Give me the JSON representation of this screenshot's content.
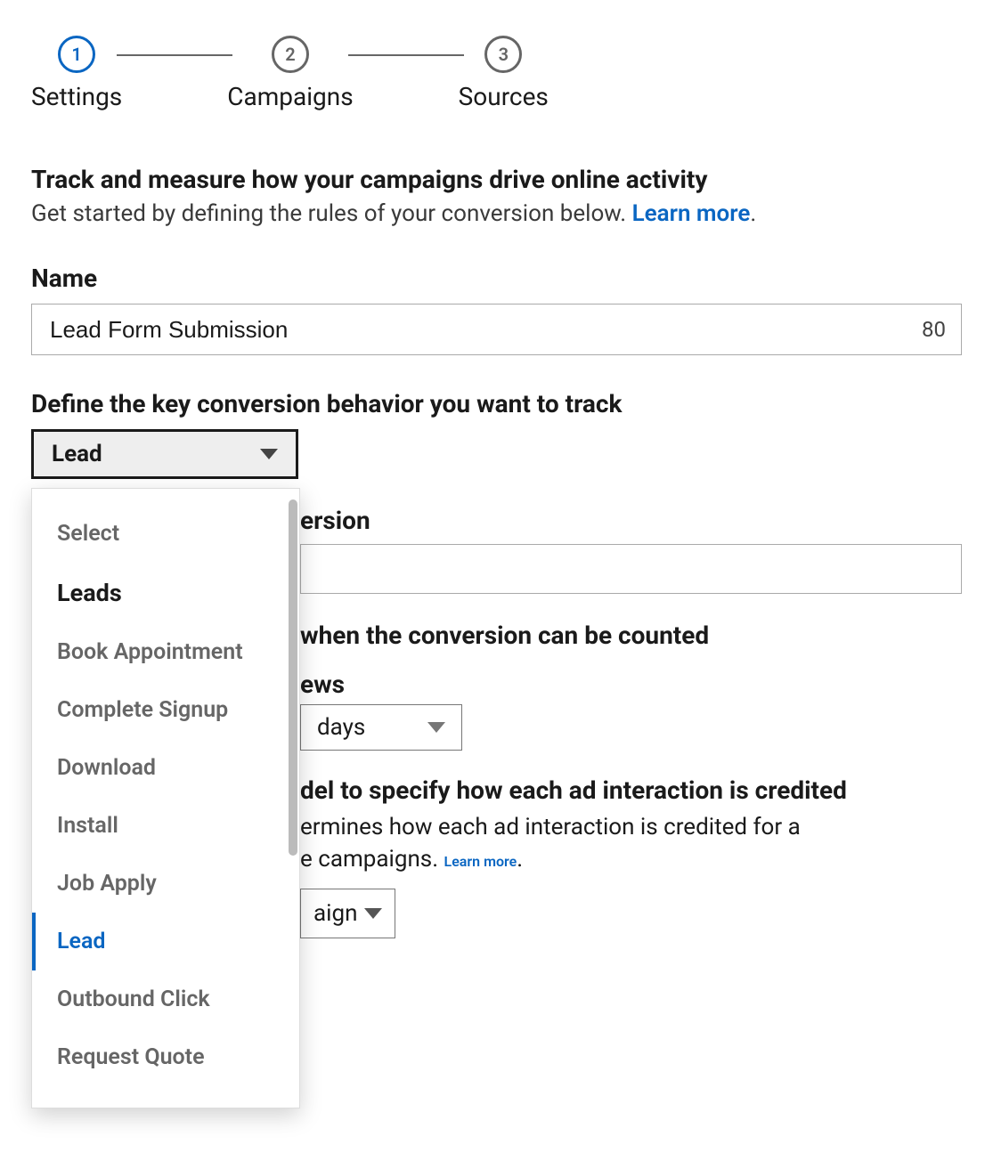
{
  "stepper": {
    "steps": [
      {
        "num": "1",
        "label": "Settings",
        "active": true
      },
      {
        "num": "2",
        "label": "Campaigns",
        "active": false
      },
      {
        "num": "3",
        "label": "Sources",
        "active": false
      }
    ]
  },
  "intro": {
    "heading": "Track and measure how your campaigns drive online activity",
    "sub_prefix": "Get started by defining the rules of your conversion below. ",
    "learn_more": "Learn more"
  },
  "name_field": {
    "label": "Name",
    "value": "Lead Form Submission",
    "char_remaining": "80"
  },
  "behavior": {
    "label": "Define the key conversion behavior you want to track",
    "selected": "Lead",
    "options": {
      "placeholder": "Select",
      "group": "Leads",
      "items": [
        "Book Appointment",
        "Complete Signup",
        "Download",
        "Install",
        "Job Apply",
        "Lead",
        "Outbound Click",
        "Request Quote"
      ]
    }
  },
  "value_section": {
    "label_fragment": "ersion"
  },
  "timeframe": {
    "heading_fragment": "when the conversion can be counted",
    "sub_fragment": "ews",
    "days_label": "days"
  },
  "attribution": {
    "heading_fragment": "del to specify how each ad interaction is credited",
    "body_fragment_1": "ermines how each ad interaction is credited for a",
    "body_fragment_2_prefix": "e campaigns. ",
    "learn_more": "Learn more",
    "select_fragment": "aign"
  }
}
